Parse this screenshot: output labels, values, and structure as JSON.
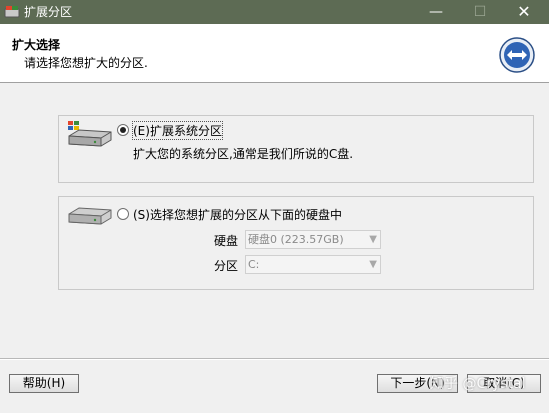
{
  "window": {
    "title": "扩展分区",
    "minimize_glyph": "—",
    "maximize_glyph": "☐",
    "close_glyph": "✕"
  },
  "header": {
    "title": "扩大选择",
    "subtitle": "请选择您想扩大的分区.",
    "icon": "resize-arrows-icon"
  },
  "options": [
    {
      "selected": true,
      "label": "(E)扩展系统分区",
      "description": "扩大您的系统分区,通常是我们所说的C盘.",
      "icon": "system-disk-icon"
    },
    {
      "selected": false,
      "label": "(S)选择您想扩展的分区从下面的硬盘中",
      "icon": "hard-disk-icon",
      "disk_label": "硬盘",
      "disk_value": "硬盘0 (223.57GB)",
      "partition_label": "分区",
      "partition_value": "C:"
    }
  ],
  "buttons": {
    "help": "帮助(H)",
    "next": "下一步(N)",
    "cancel": "取消(C)"
  },
  "watermark": "知乎 @Crystal"
}
